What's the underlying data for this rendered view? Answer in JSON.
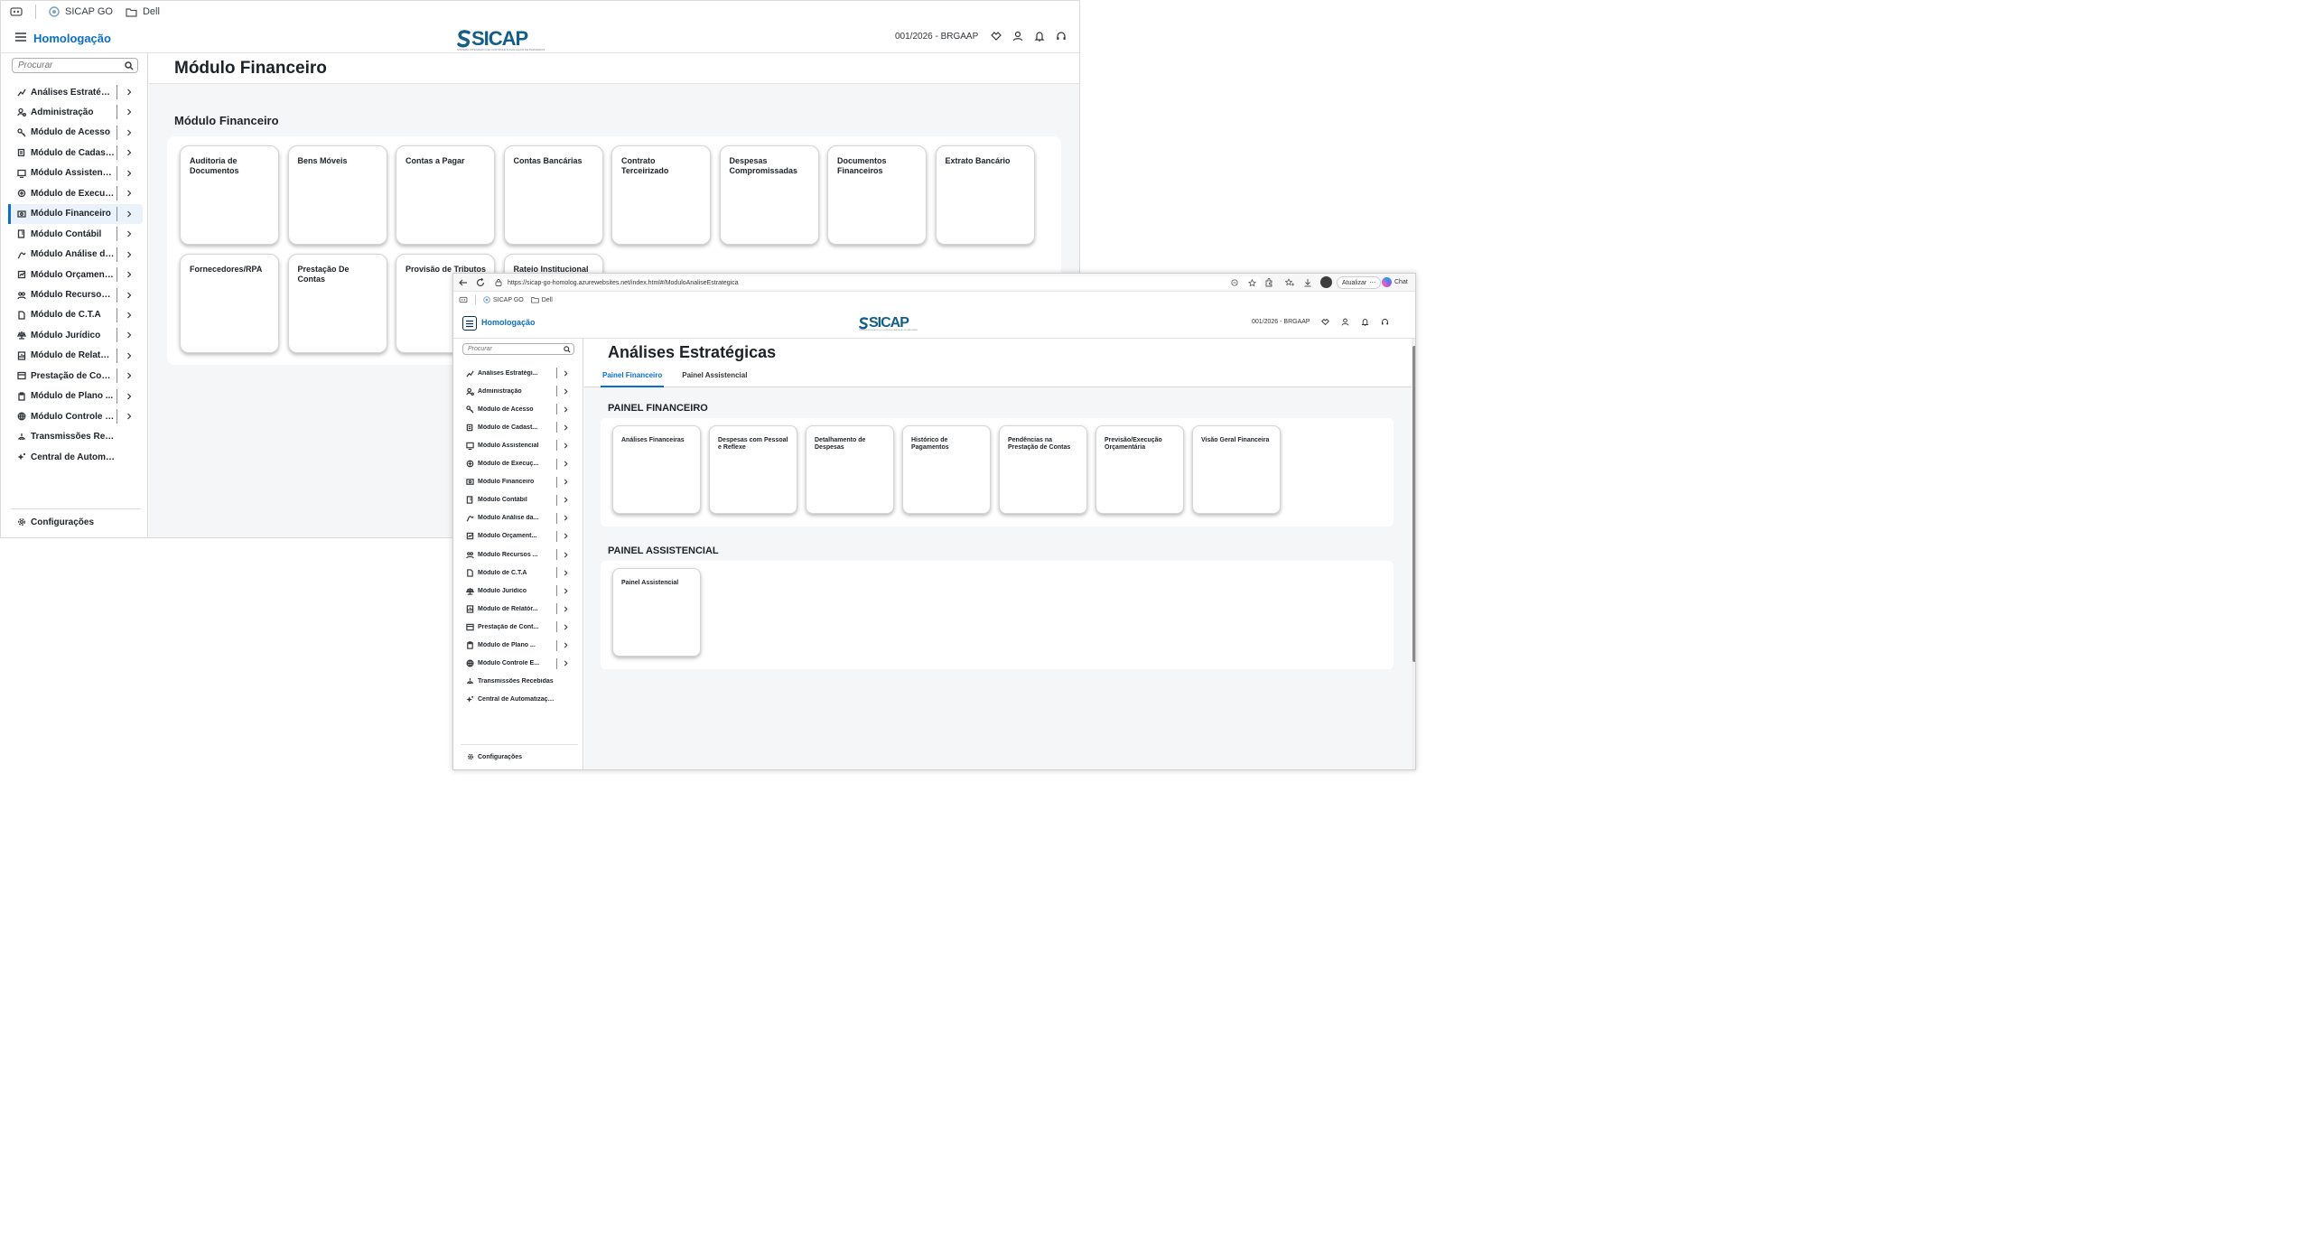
{
  "bookmarks": {
    "sicap": "SICAP GO",
    "dell": "Dell"
  },
  "header": {
    "app_title": "Homologação",
    "logo_text": "SICAP",
    "logo_sub": "SISTEMA INTEGRADO DE CONTROLE E AVALIAÇÃO DE PARCERIAS",
    "org_code": "001/2026 - BRGAAP"
  },
  "search": {
    "placeholder": "Procurar"
  },
  "sidebar": {
    "items": [
      {
        "label": "Análises Estratégi...",
        "icon": "chart-line-icon"
      },
      {
        "label": "Administração",
        "icon": "user-admin-icon"
      },
      {
        "label": "Módulo de Acesso",
        "icon": "key-icon"
      },
      {
        "label": "Módulo de Cadast...",
        "icon": "register-icon"
      },
      {
        "label": "Módulo Assistencial",
        "icon": "board-icon"
      },
      {
        "label": "Módulo de Execuç...",
        "icon": "cycle-icon"
      },
      {
        "label": "Módulo Financeiro",
        "icon": "money-icon"
      },
      {
        "label": "Módulo Contábil",
        "icon": "ledger-icon"
      },
      {
        "label": "Módulo Análise da...",
        "icon": "analysis-icon"
      },
      {
        "label": "Módulo Orçament...",
        "icon": "budget-icon"
      },
      {
        "label": "Módulo Recursos ...",
        "icon": "people-icon"
      },
      {
        "label": "Módulo de C.T.A",
        "icon": "document-icon"
      },
      {
        "label": "Módulo Jurídico",
        "icon": "scale-icon"
      },
      {
        "label": "Módulo de Relatór...",
        "icon": "report-icon"
      },
      {
        "label": "Prestação de Cont...",
        "icon": "accounts-icon"
      },
      {
        "label": "Módulo de Plano ...",
        "icon": "clipboard-icon"
      },
      {
        "label": "Módulo Controle E...",
        "icon": "globe-icon"
      },
      {
        "label": "Transmissões Recebidas",
        "icon": "transmission-icon"
      },
      {
        "label": "Central de Automatização",
        "icon": "sparkle-icon"
      }
    ],
    "active_index": 6,
    "settings_label": "Configurações"
  },
  "back_window": {
    "page_title": "Módulo Financeiro",
    "section_title": "Módulo Financeiro",
    "tiles": [
      "Auditoria de Documentos",
      "Bens Móveis",
      "Contas a Pagar",
      "Contas Bancárias",
      "Contrato Terceirizado",
      "Despesas Compromissadas",
      "Documentos Financeiros",
      "Extrato Bancário",
      "Fornecedores/RPA",
      "Prestação De Contas",
      "Provisão de Tributos",
      "Rateio Institucional"
    ]
  },
  "front_window": {
    "url": "https://sicap-go-homolog.azurewebsites.net/index.html#/ModuloAnaliseEstrategica",
    "update_label": "Atualizar",
    "chat_label": "Chat",
    "page_title": "Análises Estratégicas",
    "tabs": [
      {
        "label": "Painel Financeiro",
        "active": true
      },
      {
        "label": "Painel Assistencial",
        "active": false
      }
    ],
    "section_financeiro": "PAINEL FINANCEIRO",
    "tiles_financeiro": [
      "Análises Financeiras",
      "Despesas com Pessoal e Reflexe",
      "Detalhamento de Despesas",
      "Histórico de Pagamentos",
      "Pendências na Prestação de Contas",
      "Previsão/Execução Orçamentária",
      "Visão Geral Financeira"
    ],
    "section_assistencial": "PAINEL ASSISTENCIAL",
    "tiles_assistencial": [
      "Painel Assistencial"
    ]
  },
  "colors": {
    "accent": "#0a6ed1",
    "logo": "#135e8a",
    "content_bg": "#f5f6f7",
    "title": "#1d2228"
  }
}
